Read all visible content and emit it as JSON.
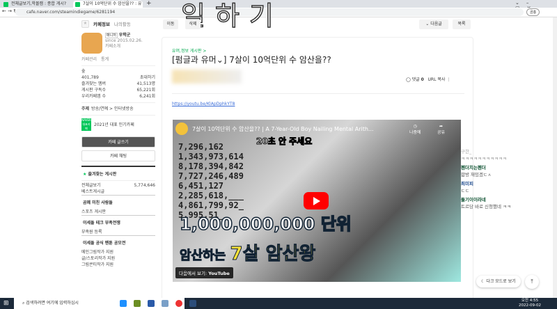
{
  "browser": {
    "tabs": [
      {
        "label": "전체글보기,학몰캠 : 종합 게시?"
      },
      {
        "label": "7살이 10억단위 수 암산을?? : 유"
      }
    ],
    "url": "cafe.naver.com/steamindiegame/6281194",
    "profile_label": "곰홍"
  },
  "overlay_text": "일하기",
  "sidebar": {
    "tab_info": "카페정보",
    "tab_activity": "나의활동",
    "manager_badge": "매니저",
    "manager_name": "우학군",
    "since": "since 2015.02.26.",
    "cafe_intro": "카페소개",
    "manage": "카페관리",
    "stats": "통계",
    "level": "숲",
    "members": "401,789",
    "invite": "초대하기",
    "stat_rows": [
      {
        "label": "즐겨찾는 멤버",
        "value": "41,513명"
      },
      {
        "label": "게시판 구독수",
        "value": "65,221회"
      },
      {
        "label": "우리카페앱 수",
        "value": "6,241회"
      }
    ],
    "topic_label": "주제",
    "topic": "방송/연예 > 인터넷방송",
    "award_badge": "NAVER 대표카페",
    "award": "2021년 대표 인기카페",
    "write": "카페 글쓰기",
    "chat": "카페 채팅",
    "favorites": "즐겨찾는 게시판",
    "boards": [
      {
        "label": "전체글보기",
        "count": "5,774,646"
      },
      {
        "label": "베스트게시글"
      }
    ],
    "sec1": "곰혜 미친 사람들",
    "sec1_items": [
      "스포츠 게시판"
    ],
    "sec2": "이세돌 테크 부족전쟁",
    "sec2_items": [
      "부족원 등록"
    ],
    "sec3": "이세돌 공식 팬툰 공모전",
    "sec3_items": [
      "메인그림작가 지원",
      "글/스토리작가 지원",
      "그림콘티작가 지원"
    ]
  },
  "toolbar": {
    "move": "이동",
    "delete": "삭제",
    "next": "다음글",
    "list": "목록"
  },
  "post": {
    "board": "유머,정보 게시판 >",
    "title": "[펌글과 유머⌄] 7살이 10억단위 수 암산을??",
    "comments_label": "댓글",
    "comments": "0",
    "url_copy": "URL 복사",
    "link": "https://youtu.be/KlApDphkYT8"
  },
  "video": {
    "title": "7살이 10억단위 수 암산을?? | A 7-Year-Old Boy Nailing Mental Arith...",
    "later": "나중에",
    "share": "공유",
    "caption_top": "20초 안 주세요",
    "caption_big": "1,000,000,000 단위",
    "caption_bottom_a": "암산하는",
    "caption_bottom_b": "7살 암산왕",
    "watch_on": "다음에서 보기:",
    "youtube": "YouTube",
    "numbers": [
      "7,296,162",
      "1,343,973,614",
      "8,178,394,842",
      "7,727,246,489",
      "6,451,127",
      "2,285,618,___",
      "4,861,799,92_",
      "5,995,51_"
    ]
  },
  "chat": [
    {
      "name": "구한_",
      "msg": "ㅋㅋㅋㅋㅋㅋㅋㅋㅋㅋㅋ"
    },
    {
      "name": "펜더치는펜더",
      "msg": "합방 재밌겠ㄷㅅ"
    },
    {
      "name": "최미피",
      "msg": "ㄷㄷ"
    },
    {
      "name": "둘기이이라네",
      "msg": "트르당 바로 신청했네 ㅋㅋ"
    }
  ],
  "dark_mode": "다크 모드로 보기",
  "taskbar": {
    "search": "검색하려면 여기에 입력하십시",
    "time": "오전 4:55",
    "date": "2022-09-02"
  }
}
